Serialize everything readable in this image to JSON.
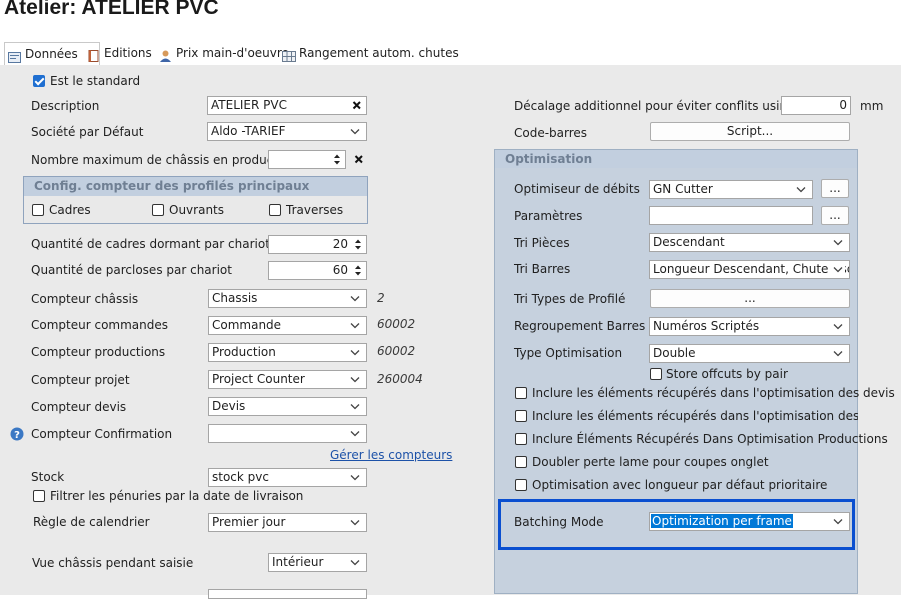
{
  "window_title": "Atelier: ATELIER PVC",
  "tabs": [
    {
      "label": "Données",
      "icon": "data-tab-icon",
      "active": true
    },
    {
      "label": "Editions",
      "icon": "book-icon",
      "active": false
    },
    {
      "label": "Prix main-d'oeuvre",
      "icon": "person-icon",
      "active": false
    },
    {
      "label": "Rangement autom. chutes",
      "icon": "grid-icon",
      "active": false
    }
  ],
  "left": {
    "standard_label": "Est le standard",
    "description_label": "Description",
    "description_value": "ATELIER PVC",
    "societe_label": "Société par Défaut",
    "societe_value": "Aldo -TARIEF",
    "max_chassis_label": "Nombre maximum de châssis en production",
    "max_chassis_value": "",
    "config_title": "Config. compteur des profilés principaux",
    "cadres_label": "Cadres",
    "ouvrants_label": "Ouvrants",
    "traverses_label": "Traverses",
    "qte_cadres_label": "Quantité de cadres dormant par chariot",
    "qte_cadres_value": "20",
    "qte_parcloses_label": "Quantité de parcloses par chariot",
    "qte_parcloses_value": "60",
    "cpt_chassis_label": "Compteur châssis",
    "cpt_chassis_value": "Chassis",
    "cpt_chassis_num": "2",
    "cpt_commandes_label": "Compteur commandes",
    "cpt_commandes_value": "Commande",
    "cpt_commandes_num": "60002",
    "cpt_productions_label": "Compteur productions",
    "cpt_productions_value": "Production",
    "cpt_productions_num": "60002",
    "cpt_projet_label": "Compteur projet",
    "cpt_projet_value": "Project Counter",
    "cpt_projet_num": "260004",
    "cpt_devis_label": "Compteur devis",
    "cpt_devis_value": "Devis",
    "cpt_confirmation_label": "Compteur Confirmation",
    "cpt_confirmation_value": "",
    "gerer_link": "Gérer les compteurs",
    "stock_label": "Stock",
    "stock_value": "stock pvc",
    "filtrer_label": "Filtrer les pénuries par la date de livraison",
    "regle_label": "Règle de calendrier",
    "regle_value": "Premier jour",
    "vue_label": "Vue châssis pendant saisie",
    "vue_value": "Intérieur"
  },
  "right": {
    "decalage_label": "Décalage additionnel pour éviter conflits usinages",
    "decalage_value": "0",
    "decalage_unit": "mm",
    "codebarres_label": "Code-barres",
    "script_button": "Script...",
    "opt_title": "Optimisation",
    "optimiseur_label": "Optimiseur de débits",
    "optimiseur_value": "GN Cutter",
    "dots": "...",
    "parametres_label": "Paramètres",
    "parametres_value": "",
    "tri_pieces_label": "Tri Pièces",
    "tri_pieces_value": "Descendant",
    "tri_barres_label": "Tri Barres",
    "tri_barres_value": "Longueur Descendant, Chute Ascend",
    "tri_types_label": "Tri Types de Profilé",
    "regroupement_label": "Regroupement Barres",
    "regroupement_value": "Numéros Scriptés",
    "type_opt_label": "Type Optimisation",
    "type_opt_value": "Double",
    "store_offcuts_label": "Store offcuts by pair",
    "incl_devis_label": "Inclure les éléments récupérés dans l'optimisation des devis",
    "incl_commandes_label": "Inclure les éléments récupérés dans l'optimisation des commande",
    "incl_productions_label": "Inclure Éléments Récupérés Dans Optimisation Productions",
    "doubler_label": "Doubler perte lame pour coupes onglet",
    "opt_longueur_label": "Optimisation avec longueur par défaut prioritaire",
    "batching_label": "Batching Mode",
    "batching_value": "Optimization per frame"
  },
  "colors": {
    "accent": "#1f6fd1",
    "highlight_border": "#0a4fd0",
    "panel_bg": "#c6d1de",
    "selection_bg": "#0078d7"
  }
}
